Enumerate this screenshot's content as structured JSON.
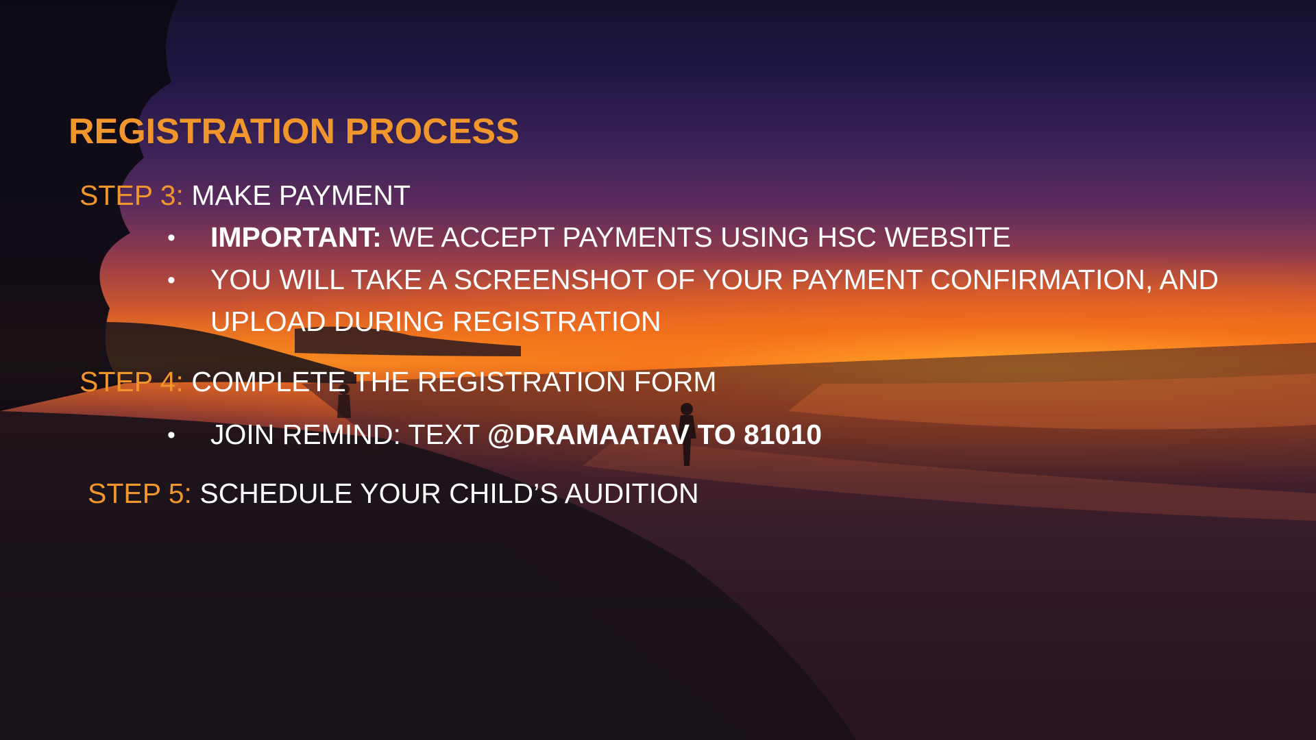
{
  "slide": {
    "title": "REGISTRATION PROCESS",
    "accent_color": "#f0962c",
    "text_color": "#ffffff",
    "steps": [
      {
        "label": "STEP 3:",
        "text": "MAKE PAYMENT",
        "bullets": [
          {
            "bold": "IMPORTANT:",
            "text": "WE ACCEPT PAYMENTS USING HSC WEBSITE"
          },
          {
            "text": "YOU WILL TAKE A SCREENSHOT OF YOUR PAYMENT CONFIRMATION, AND",
            "text_cont": "UPLOAD DURING REGISTRATION"
          }
        ]
      },
      {
        "label": "STEP 4:",
        "text": "COMPLETE THE REGISTRATION FORM",
        "bullets": [
          {
            "text": "JOIN REMIND: TEXT",
            "bold": "@DRAMAATAV TO 81010"
          }
        ]
      },
      {
        "label": "STEP 5:",
        "text": "SCHEDULE YOUR CHILD’S AUDITION"
      }
    ],
    "bullet_glyph": "•"
  }
}
